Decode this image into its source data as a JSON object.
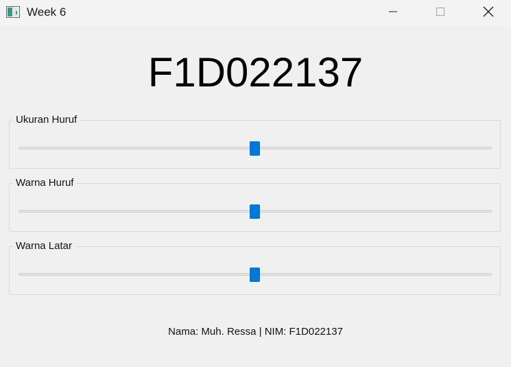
{
  "window": {
    "title": "Week 6",
    "icon": "app-window-icon"
  },
  "main": {
    "display_text": "F1D022137"
  },
  "groups": [
    {
      "label": "Ukuran Huruf",
      "slider_value": 0.5
    },
    {
      "label": "Warna Huruf",
      "slider_value": 0.5
    },
    {
      "label": "Warna Latar",
      "slider_value": 0.5
    }
  ],
  "footer": {
    "text": "Nama: Muh. Ressa | NIM: F1D022137"
  },
  "colors": {
    "accent": "#0078d7",
    "background": "#f0f0f0"
  }
}
